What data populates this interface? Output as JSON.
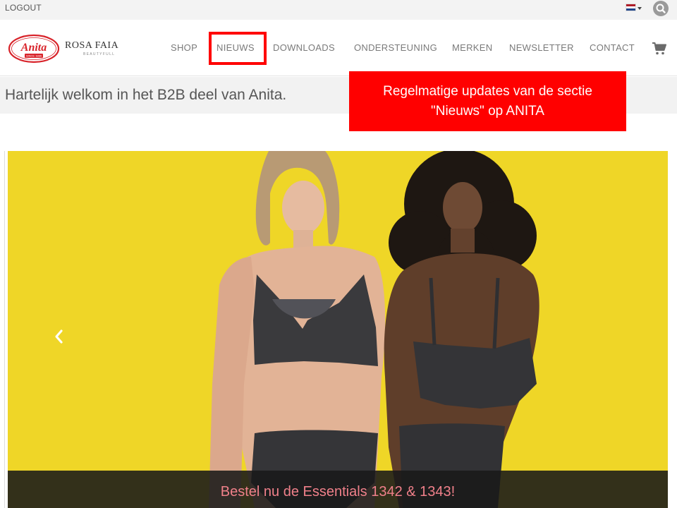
{
  "topbar": {
    "logout_label": "LOGOUT",
    "language_flag": "flag-nl-icon",
    "search_icon": "search-icon"
  },
  "brand": {
    "anita_name": "Anita",
    "anita_since": "SINCE 1886",
    "rosa_name": "ROSA FAIA",
    "rosa_sub": "BEAUTYFULL"
  },
  "nav": {
    "items": [
      {
        "label": "SHOP"
      },
      {
        "label": "NIEUWS",
        "highlighted": true
      },
      {
        "label": "DOWNLOADS"
      },
      {
        "label": "ONDERSTEUNING"
      },
      {
        "label": "MERKEN"
      },
      {
        "label": "NEWSLETTER"
      },
      {
        "label": "CONTACT"
      }
    ],
    "cart_icon": "cart-icon"
  },
  "welcome": {
    "text": "Hartelijk welkom in het B2B deel van Anita."
  },
  "callout": {
    "line1": "Regelmatige updates van de sectie",
    "line2": "\"Nieuws\" op ANITA"
  },
  "hero": {
    "caption": "Bestel nu de Essentials 1342 & 1343!",
    "prev_icon": "chevron-left-icon"
  },
  "colors": {
    "accent_red": "#ff0000",
    "anita_red": "#d8232a",
    "hero_bg": "#efd627",
    "caption_text": "#f0808a"
  }
}
